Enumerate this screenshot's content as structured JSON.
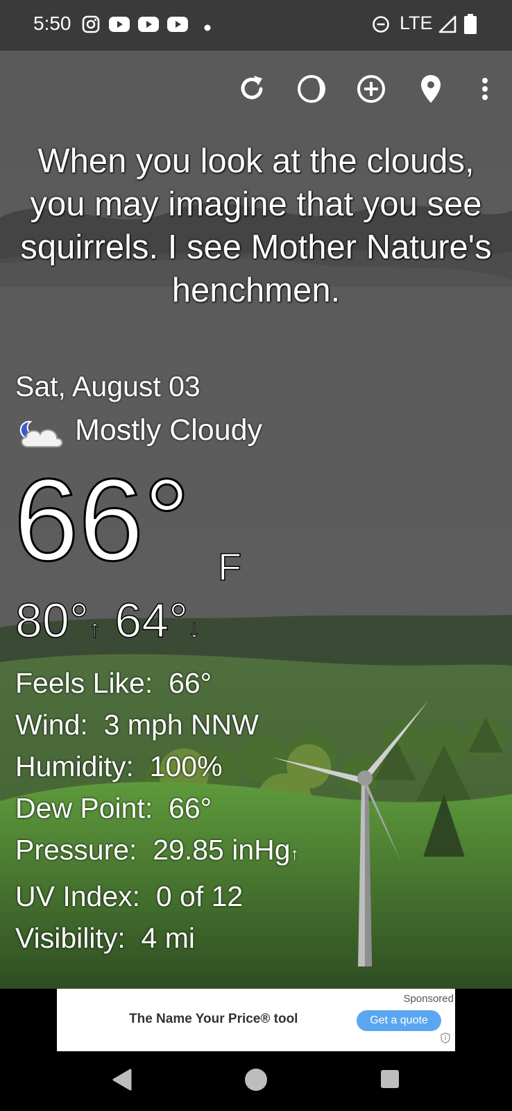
{
  "status_bar": {
    "time": "5:50",
    "network": "LTE",
    "icons": [
      "instagram-icon",
      "youtube-icon",
      "youtube-icon",
      "youtube-icon",
      "dot-icon",
      "dnd-icon",
      "signal-icon",
      "battery-icon"
    ]
  },
  "toolbar": {
    "buttons": [
      "refresh-icon",
      "moon-phase-icon",
      "add-location-icon",
      "location-pin-icon",
      "more-vert-icon"
    ]
  },
  "quote": "When you look at the clouds, you may imagine that you see squirrels. I see Mother Nature's henchmen.",
  "weather": {
    "date": "Sat, August 03",
    "condition": "Mostly Cloudy",
    "condition_icon": "partly-cloudy-night-icon",
    "temperature": "66°",
    "unit": "F",
    "high": "80°",
    "low": "64°",
    "details": [
      {
        "label": "Feels Like:",
        "value": "66°"
      },
      {
        "label": "Wind:",
        "value": "3 mph NNW"
      },
      {
        "label": "Humidity:",
        "value": "100%"
      },
      {
        "label": "Dew Point:",
        "value": "66°"
      },
      {
        "label": "Pressure:",
        "value": "29.85 inHg"
      },
      {
        "label": "UV Index:",
        "value": "0 of 12"
      },
      {
        "label": "Visibility:",
        "value": "4 mi"
      }
    ]
  },
  "ad": {
    "title": "The Name Your Price® tool",
    "sponsored": "Sponsored",
    "cta": "Get a quote"
  },
  "colors": {
    "status_bar": "#3a3a3a",
    "sky": "#5b5b5b",
    "grass": "#5e9a3c",
    "ad_button": "#5aa6f0"
  }
}
